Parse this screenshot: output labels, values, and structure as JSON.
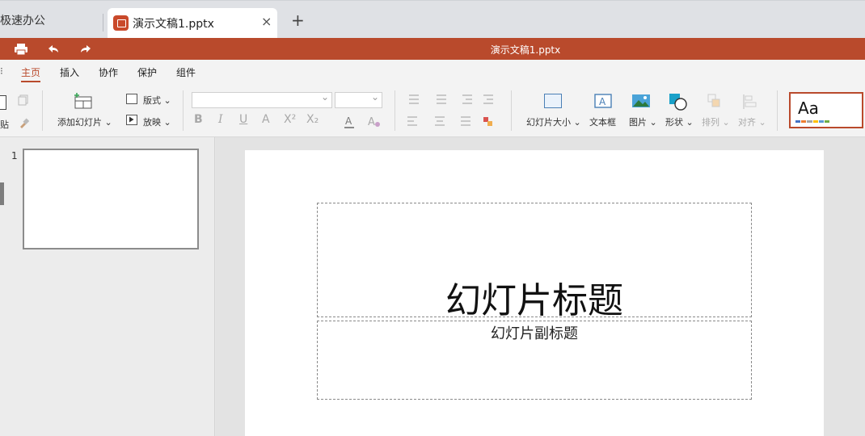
{
  "tabs": {
    "home_label": "极速办公",
    "active_title": "演示文稿1.pptx",
    "close_glyph": "×",
    "new_glyph": "+"
  },
  "titlebar": {
    "title": "演示文稿1.pptx"
  },
  "menu": {
    "items": [
      "主页",
      "插入",
      "协作",
      "保护",
      "组件"
    ],
    "active": "主页"
  },
  "ribbon": {
    "add_slide": "添加幻灯片",
    "layout": "版式",
    "play": "放映",
    "slide_size": "幻灯片大小",
    "text_box": "文本框",
    "picture": "图片",
    "shape": "形状",
    "arrange": "排列",
    "align": "对齐",
    "paste_partial": "贴",
    "format_glyphs": {
      "bold": "B",
      "italic": "I",
      "underline": "U",
      "strike": "A",
      "superscript": "X²",
      "subscript": "X₂"
    },
    "theme_label": "Aa",
    "theme_colors": [
      "#4472c4",
      "#ed7d31",
      "#a5a5a5",
      "#ffc000",
      "#5b9bd5",
      "#70ad47"
    ]
  },
  "slides_panel": {
    "slide_number": "1"
  },
  "slide": {
    "title_placeholder": "幻灯片标题",
    "subtitle_placeholder": "幻灯片副标题"
  },
  "colors": {
    "accent": "#b94a2c",
    "background": "#e6e6e6"
  }
}
